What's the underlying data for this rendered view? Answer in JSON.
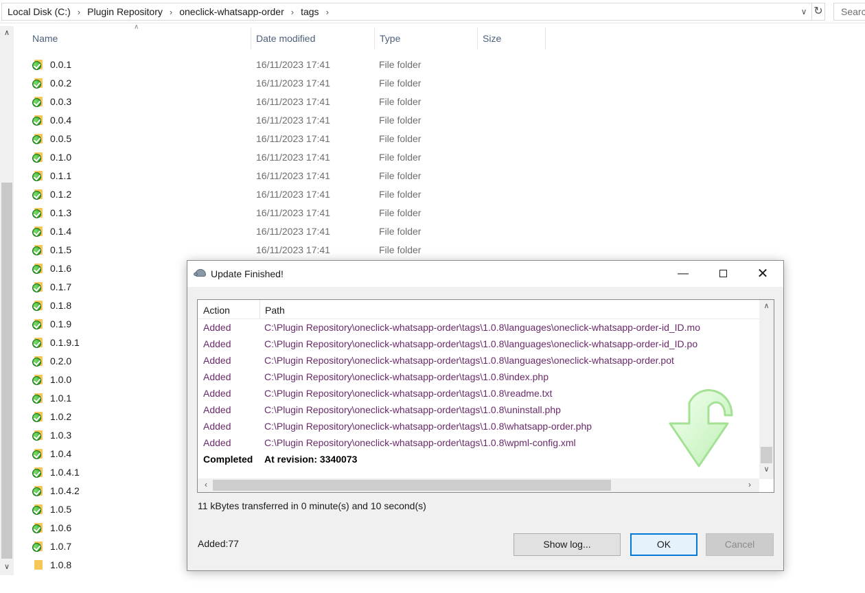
{
  "breadcrumb": [
    "Local Disk (C:)",
    "Plugin Repository",
    "oneclick-whatsapp-order",
    "tags"
  ],
  "search": {
    "placeholder": "Search"
  },
  "columns": {
    "name": "Name",
    "date": "Date modified",
    "type": "Type",
    "size": "Size"
  },
  "files": [
    {
      "name": "0.0.1",
      "date": "16/11/2023 17:41",
      "type": "File folder",
      "status": "normal"
    },
    {
      "name": "0.0.2",
      "date": "16/11/2023 17:41",
      "type": "File folder",
      "status": "normal"
    },
    {
      "name": "0.0.3",
      "date": "16/11/2023 17:41",
      "type": "File folder",
      "status": "normal"
    },
    {
      "name": "0.0.4",
      "date": "16/11/2023 17:41",
      "type": "File folder",
      "status": "normal"
    },
    {
      "name": "0.0.5",
      "date": "16/11/2023 17:41",
      "type": "File folder",
      "status": "normal"
    },
    {
      "name": "0.1.0",
      "date": "16/11/2023 17:41",
      "type": "File folder",
      "status": "normal"
    },
    {
      "name": "0.1.1",
      "date": "16/11/2023 17:41",
      "type": "File folder",
      "status": "normal"
    },
    {
      "name": "0.1.2",
      "date": "16/11/2023 17:41",
      "type": "File folder",
      "status": "normal"
    },
    {
      "name": "0.1.3",
      "date": "16/11/2023 17:41",
      "type": "File folder",
      "status": "normal"
    },
    {
      "name": "0.1.4",
      "date": "16/11/2023 17:41",
      "type": "File folder",
      "status": "normal"
    },
    {
      "name": "0.1.5",
      "date": "16/11/2023 17:41",
      "type": "File folder",
      "status": "normal"
    },
    {
      "name": "0.1.6",
      "date": "",
      "type": "",
      "status": "normal"
    },
    {
      "name": "0.1.7",
      "date": "",
      "type": "",
      "status": "normal"
    },
    {
      "name": "0.1.8",
      "date": "",
      "type": "",
      "status": "normal"
    },
    {
      "name": "0.1.9",
      "date": "",
      "type": "",
      "status": "normal"
    },
    {
      "name": "0.1.9.1",
      "date": "",
      "type": "",
      "status": "normal"
    },
    {
      "name": "0.2.0",
      "date": "",
      "type": "",
      "status": "normal"
    },
    {
      "name": "1.0.0",
      "date": "",
      "type": "",
      "status": "normal"
    },
    {
      "name": "1.0.1",
      "date": "",
      "type": "",
      "status": "normal"
    },
    {
      "name": "1.0.2",
      "date": "",
      "type": "",
      "status": "normal"
    },
    {
      "name": "1.0.3",
      "date": "",
      "type": "",
      "status": "normal"
    },
    {
      "name": "1.0.4",
      "date": "",
      "type": "",
      "status": "normal"
    },
    {
      "name": "1.0.4.1",
      "date": "",
      "type": "",
      "status": "normal"
    },
    {
      "name": "1.0.4.2",
      "date": "",
      "type": "",
      "status": "normal"
    },
    {
      "name": "1.0.5",
      "date": "",
      "type": "",
      "status": "normal"
    },
    {
      "name": "1.0.6",
      "date": "",
      "type": "",
      "status": "normal"
    },
    {
      "name": "1.0.7",
      "date": "",
      "type": "",
      "status": "normal"
    },
    {
      "name": "1.0.8",
      "date": "",
      "type": "",
      "status": "plain"
    }
  ],
  "dialog": {
    "title": "Update Finished!",
    "header": {
      "action": "Action",
      "path": "Path"
    },
    "rows": [
      {
        "action": "Added",
        "path": "C:\\Plugin Repository\\oneclick-whatsapp-order\\tags\\1.0.8\\languages\\oneclick-whatsapp-order-id_ID.mo"
      },
      {
        "action": "Added",
        "path": "C:\\Plugin Repository\\oneclick-whatsapp-order\\tags\\1.0.8\\languages\\oneclick-whatsapp-order-id_ID.po"
      },
      {
        "action": "Added",
        "path": "C:\\Plugin Repository\\oneclick-whatsapp-order\\tags\\1.0.8\\languages\\oneclick-whatsapp-order.pot"
      },
      {
        "action": "Added",
        "path": "C:\\Plugin Repository\\oneclick-whatsapp-order\\tags\\1.0.8\\index.php"
      },
      {
        "action": "Added",
        "path": "C:\\Plugin Repository\\oneclick-whatsapp-order\\tags\\1.0.8\\readme.txt"
      },
      {
        "action": "Added",
        "path": "C:\\Plugin Repository\\oneclick-whatsapp-order\\tags\\1.0.8\\uninstall.php"
      },
      {
        "action": "Added",
        "path": "C:\\Plugin Repository\\oneclick-whatsapp-order\\tags\\1.0.8\\whatsapp-order.php"
      },
      {
        "action": "Added",
        "path": "C:\\Plugin Repository\\oneclick-whatsapp-order\\tags\\1.0.8\\wpml-config.xml"
      }
    ],
    "completed": {
      "action": "Completed",
      "path": "At revision: 3340073"
    },
    "transfer": "11 kBytes transferred in 0 minute(s) and 10 second(s)",
    "added_count": "Added:77",
    "buttons": {
      "show_log": "Show log...",
      "ok": "OK",
      "cancel": "Cancel"
    }
  },
  "colors": {
    "accent": "#0078d7",
    "added_text": "#6a2a6a",
    "folder": "#f4c758",
    "status_ok": "#1d8a1d"
  }
}
